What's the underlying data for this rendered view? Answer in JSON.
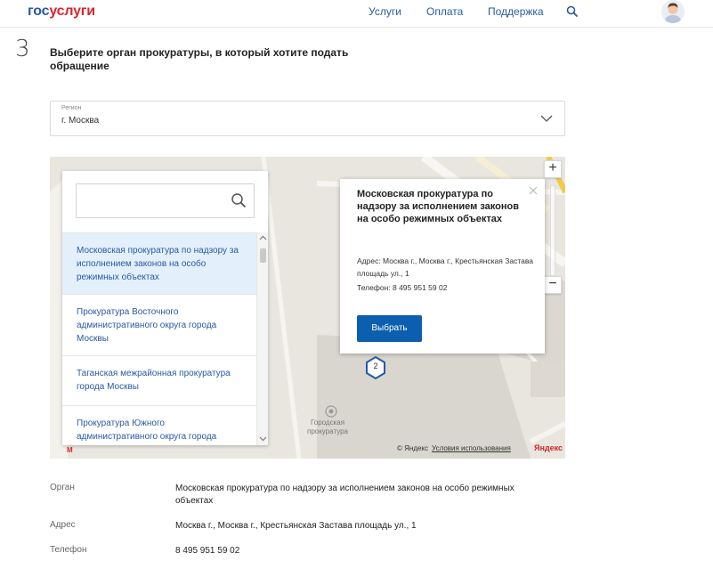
{
  "header": {
    "logo_part1": "гос",
    "logo_part2": "услуги",
    "nav": [
      "Услуги",
      "Оплата",
      "Поддержка"
    ]
  },
  "step": {
    "number": "3",
    "title": "Выберите орган прокуратуры, в который хотите подать обращение"
  },
  "region": {
    "label": "Регион",
    "value": "г. Москва"
  },
  "list": {
    "items": [
      "Московская прокуратура по надзору за исполнением законов на особо режимных объектах",
      "Прокуратура Восточного административного округа города Москвы",
      "Таганская межрайонная прокуратура города Москвы",
      "Прокуратура Южного административного округа города"
    ]
  },
  "popup": {
    "title": "Московская прокуратура по надзору за исполнением законов на особо режимных объектах",
    "address": "Адрес: Москва г., Москва г., Крестьянская Застава площадь ул., 1",
    "phone": "Телефон: 8 495 951 59 02",
    "button": "Выбрать"
  },
  "map": {
    "cluster_count": "2",
    "place_label": "Городская прокуратура",
    "copyright": "© Яндекс",
    "terms": "Условия использования",
    "logo": "Яндекс",
    "metro_label": "М",
    "zoom_in": "+",
    "zoom_out": "−"
  },
  "details": {
    "org_label": "Орган",
    "org_value": "Московская прокуратура по надзору за исполнением законов на особо режимных объектах",
    "addr_label": "Адрес",
    "addr_value": "Москва г., Москва г., Крестьянская Застава площадь ул., 1",
    "phone_label": "Телефон",
    "phone_value": "8 495 951 59 02"
  },
  "colors": {
    "brand_blue": "#2a59a6",
    "brand_red": "#d8262c",
    "button_blue": "#0c5fae",
    "active_item": "#e3f0fb"
  }
}
